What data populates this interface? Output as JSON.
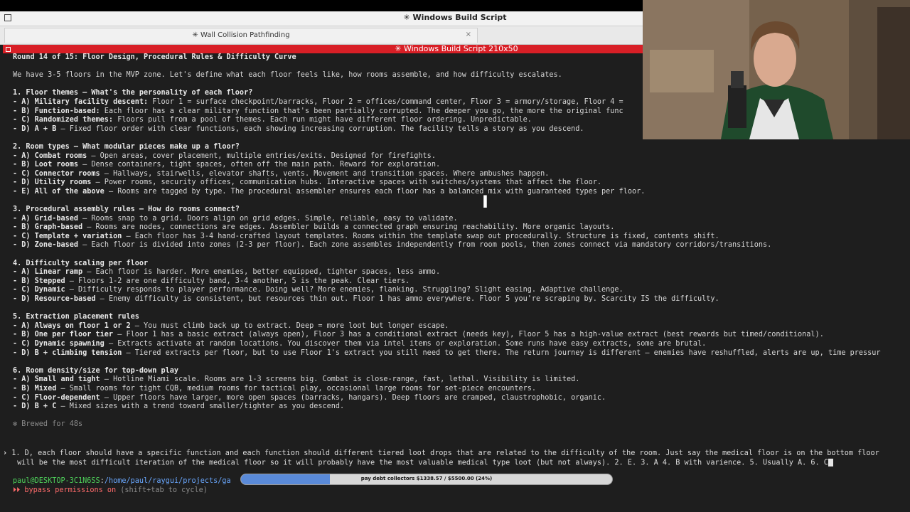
{
  "window": {
    "title": "✳ Windows Build Script"
  },
  "tab": {
    "label": "✳ Wall Collision Pathfinding",
    "close": "×"
  },
  "terminal_title": "✳ Windows Build Script 210x50",
  "content": {
    "heading": "Round 14 of 15: Floor Design, Procedural Rules & Difficulty Curve",
    "intro": "We have 3-5 floors in the MVP zone. Let's define what each floor feels like, how rooms assemble, and how difficulty escalates.",
    "s1": {
      "title": "1. Floor themes — What's the personality of each floor?",
      "a_label": "- A) Military facility descent:",
      "a_text": " Floor 1 = surface checkpoint/barracks, Floor 2 = offices/command center, Floor 3 = armory/storage, Floor 4 =",
      "b_label": "- B) Function-based:",
      "b_text": " Each floor has a clear military function that's been partially corrupted. The deeper you go, the more the original func",
      "c_label": "- C) Randomized themes:",
      "c_text": " Floors pull from a pool of themes. Each run might have different floor ordering. Unpredictable.",
      "d_label": "- D) A + B",
      "d_text": " — Fixed floor order with clear functions, each showing increasing corruption. The facility tells a story as you descend."
    },
    "s2": {
      "title": "2. Room types — What modular pieces make up a floor?",
      "a_label": "- A) Combat rooms",
      "a_text": " — Open areas, cover placement, multiple entries/exits. Designed for firefights.",
      "b_label": "- B) Loot rooms",
      "b_text": " — Dense containers, tight spaces, often off the main path. Reward for exploration.",
      "c_label": "- C) Connector rooms",
      "c_text": " — Hallways, stairwells, elevator shafts, vents. Movement and transition spaces. Where ambushes happen.",
      "d_label": "- D) Utility rooms",
      "d_text": " — Power rooms, security offices, communication hubs. Interactive spaces with switches/systems that affect the floor.",
      "e_label": "- E) All of the above",
      "e_text": " — Rooms are tagged by type. The procedural assembler ensures each floor has a balanced mix with guaranteed types per floor."
    },
    "s3": {
      "title": "3. Procedural assembly rules — How do rooms connect?",
      "a_label": "- A) Grid-based",
      "a_text": " — Rooms snap to a grid. Doors align on grid edges. Simple, reliable, easy to validate.",
      "b_label": "- B) Graph-based",
      "b_text": " — Rooms are nodes, connections are edges. Assembler builds a connected graph ensuring reachability. More organic layouts.",
      "c_label": "- C) Template + variation",
      "c_text": " — Each floor has 3-4 hand-crafted layout templates. Rooms within the template swap out procedurally. Structure is fixed, contents shift.",
      "d_label": "- D) Zone-based",
      "d_text": " — Each floor is divided into zones (2-3 per floor). Each zone assembles independently from room pools, then zones connect via mandatory corridors/transitions."
    },
    "s4": {
      "title": "4. Difficulty scaling per floor",
      "a_label": "- A) Linear ramp",
      "a_text": " — Each floor is harder. More enemies, better equipped, tighter spaces, less ammo.",
      "b_label": "- B) Stepped",
      "b_text": " — Floors 1-2 are one difficulty band, 3-4 another, 5 is the peak. Clear tiers.",
      "c_label": "- C) Dynamic",
      "c_text": " — Difficulty responds to player performance. Doing well? More enemies, flanking. Struggling? Slight easing. Adaptive challenge.",
      "d_label": "- D) Resource-based",
      "d_text": " — Enemy difficulty is consistent, but resources thin out. Floor 1 has ammo everywhere. Floor 5 you're scraping by. Scarcity IS the difficulty."
    },
    "s5": {
      "title": "5. Extraction placement rules",
      "a_label": "- A) Always on floor 1 or 2",
      "a_text": " — You must climb back up to extract. Deep = more loot but longer escape.",
      "b_label": "- B) One per floor tier",
      "b_text": " — Floor 1 has a basic extract (always open), Floor 3 has a conditional extract (needs key), Floor 5 has a high-value extract (best rewards but timed/conditional).",
      "c_label": "- C) Dynamic spawning",
      "c_text": " — Extracts activate at random locations. You discover them via intel items or exploration. Some runs have easy extracts, some are brutal.",
      "d_label": "- D) B + climbing tension",
      "d_text": " — Tiered extracts per floor, but to use Floor 1's extract you still need to get there. The return journey is different — enemies have reshuffled, alerts are up, time pressur"
    },
    "s6": {
      "title": "6. Room density/size for top-down play",
      "a_label": "- A) Small and tight",
      "a_text": " — Hotline Miami scale. Rooms are 1-3 screens big. Combat is close-range, fast, lethal. Visibility is limited.",
      "b_label": "- B) Mixed",
      "b_text": " — Small rooms for tight CQB, medium rooms for tactical play, occasional large rooms for set-piece encounters.",
      "c_label": "- C) Floor-dependent",
      "c_text": " — Upper floors have larger, more open spaces (barracks, hangars). Deep floors are cramped, claustrophobic, organic.",
      "d_label": "- D) B + C",
      "d_text": " — Mixed sizes with a trend toward smaller/tighter as you descend."
    },
    "brewed": "✻ Brewed for 48s"
  },
  "prompt": {
    "marker": "›",
    "line1": " 1. D, each floor should have a specific function and each function should different tiered loot drops that are related to the difficulty of the room. Just say the medical floor is on the bottom floor",
    "line2": " will be the most difficult iteration of the medical floor so it will probably have the most valuable medical type loot (but not always). 2. E. 3. A 4. B with varience. 5. Usually A. 6. C"
  },
  "status": {
    "user": "paul@DESKTOP-3C1N6SS",
    "sep": ":",
    "path": "/home/paul/raygui/projects/ga",
    "bypass_marker": "⏵⏵",
    "bypass_text": " bypass permissions on",
    "bypass_hint": " (shift+tab to cycle)"
  },
  "progress": {
    "label": "pay debt collectors $1338.57 / $5500.00 (24%)",
    "fraction": 0.24
  },
  "colors": {
    "accent_red": "#d81f26",
    "progress_blue": "#5a8ad8",
    "user_green": "#4fd25b",
    "path_blue": "#6aa8ff"
  }
}
